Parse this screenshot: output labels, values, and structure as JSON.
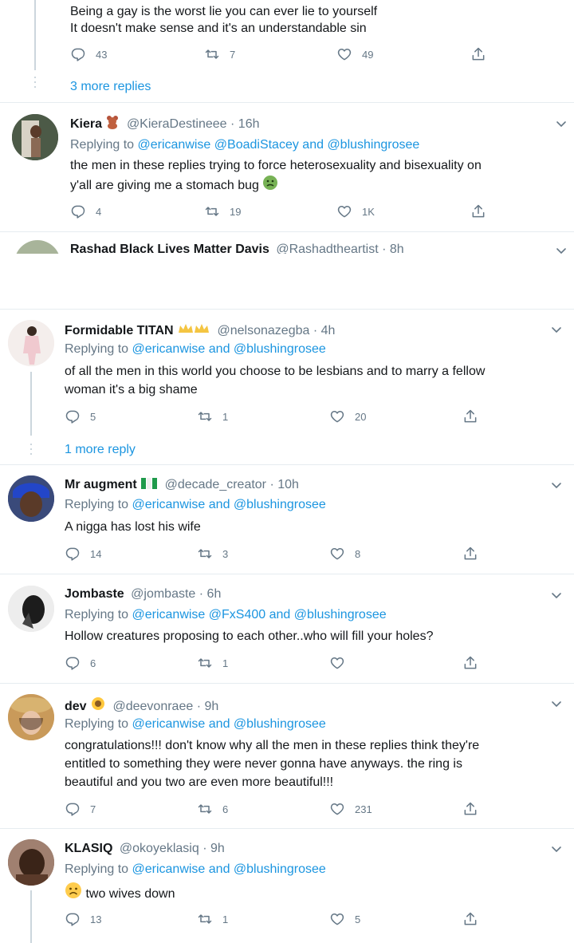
{
  "tweet0": {
    "lines": [
      "Being a gay is the worst lie you can ever lie to yourself",
      "It doesn't make sense and it's an understandable sin"
    ],
    "replies": "43",
    "retweets": "7",
    "likes": "49",
    "more_replies": "3 more replies"
  },
  "tweet1": {
    "name": "Kiera",
    "handle": "@KieraDestineee",
    "time": "· 16h",
    "replying_prefix": "Replying to",
    "replying_to": "@ericanwise @BoadiStacey and @blushingrosee",
    "lines": [
      "the men in these replies trying to force heterosexuality and bisexuality on",
      "y'all are giving me a stomach bug"
    ],
    "replies": "4",
    "retweets": "19",
    "likes": "1K"
  },
  "tweet2": {
    "name": "Rashad Black Lives Matter Davis",
    "handle": "@Rashadtheartist",
    "time": "· 8h"
  },
  "tweet3": {
    "name": "Formidable TITAN",
    "handle": "@nelsonazegba",
    "time": "· 4h",
    "replying_prefix": "Replying to",
    "replying_to": "@ericanwise and @blushingrosee",
    "lines": [
      "of all the men in this world you choose to be lesbians and to marry a fellow",
      "woman it's a big shame"
    ],
    "replies": "5",
    "retweets": "1",
    "likes": "20",
    "more_replies": "1 more reply"
  },
  "tweet4": {
    "name": "Mr augment",
    "handle": "@decade_creator",
    "time": "· 10h",
    "replying_prefix": "Replying to",
    "replying_to": "@ericanwise and @blushingrosee",
    "lines": [
      "A nigga has lost his wife"
    ],
    "replies": "14",
    "retweets": "3",
    "likes": "8"
  },
  "tweet5": {
    "name": "Jombaste",
    "handle": "@jombaste",
    "time": "· 6h",
    "replying_prefix": "Replying to",
    "replying_to": "@ericanwise @FxS400 and @blushingrosee",
    "lines": [
      "Hollow creatures proposing to each other..who will fill your holes?"
    ],
    "replies": "6",
    "retweets": "1",
    "likes": ""
  },
  "tweet6": {
    "name": "dev",
    "handle": "@deevonraee",
    "time": "· 9h",
    "replying_prefix": "Replying to",
    "replying_to": "@ericanwise and @blushingrosee",
    "lines": [
      "congratulations!!! don't know why all the men in these replies think they're",
      "entitled to something they were never gonna have anyways. the ring is",
      "beautiful and you two are even more beautiful!!!"
    ],
    "replies": "7",
    "retweets": "6",
    "likes": "231"
  },
  "tweet7": {
    "name": "KLASIQ",
    "handle": "@okoyeklasiq",
    "time": "· 9h",
    "replying_prefix": "Replying to",
    "replying_to": "@ericanwise and @blushingrosee",
    "lines": [
      "two wives down"
    ],
    "replies": "13",
    "retweets": "1",
    "likes": "5"
  },
  "colors": {
    "link": "#1b95e0",
    "muted": "#657786",
    "divider": "#e6ecf0"
  }
}
